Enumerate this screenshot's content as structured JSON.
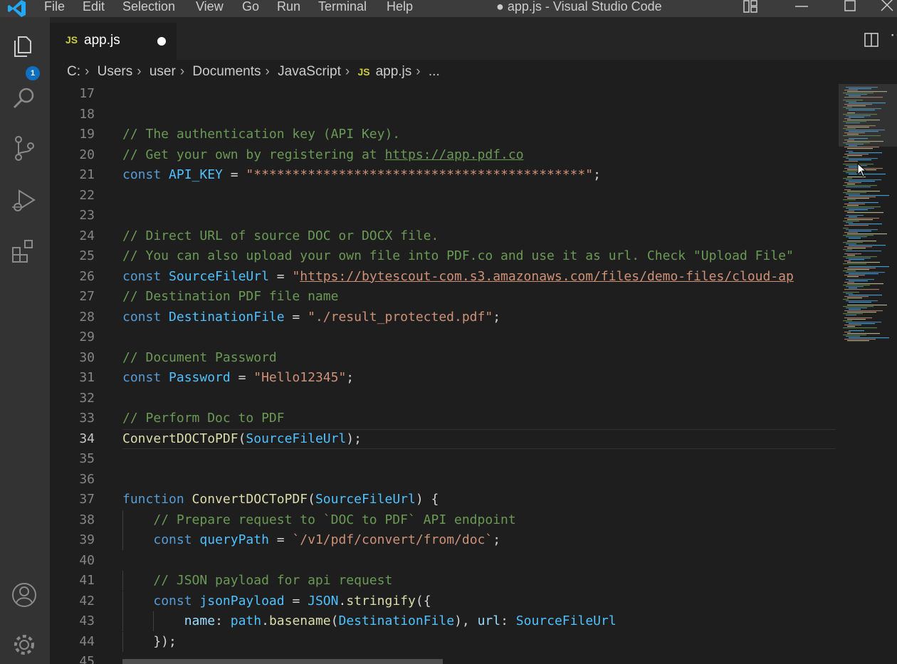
{
  "window": {
    "title": "● app.js - Visual Studio Code",
    "menu": [
      "File",
      "Edit",
      "Selection",
      "View",
      "Go",
      "Run",
      "Terminal",
      "Help"
    ]
  },
  "activity_bar": {
    "explorer_badge": "1",
    "icons": [
      "files-icon",
      "search-icon",
      "source-control-icon",
      "run-debug-icon",
      "extensions-icon",
      "account-icon",
      "settings-gear-icon"
    ]
  },
  "tab": {
    "language_badge": "JS",
    "label": "app.js",
    "dirty": true
  },
  "breadcrumb": {
    "items": [
      "C:",
      "Users",
      "user",
      "Documents",
      "JavaScript"
    ],
    "file_badge": "JS",
    "file": "app.js",
    "symbol": "..."
  },
  "editor": {
    "current_line": 34,
    "lines": [
      {
        "n": "17",
        "t": ""
      },
      {
        "n": "18",
        "t": ""
      },
      {
        "n": "19",
        "t": "// The authentication key (API Key)."
      },
      {
        "n": "20",
        "t": "// Get your own by registering at https://app.pdf.co"
      },
      {
        "n": "21",
        "t": "const API_KEY = \"*******************************************\";"
      },
      {
        "n": "22",
        "t": ""
      },
      {
        "n": "23",
        "t": ""
      },
      {
        "n": "24",
        "t": "// Direct URL of source DOC or DOCX file."
      },
      {
        "n": "25",
        "t": "// You can also upload your own file into PDF.co and use it as url. Check \"Upload File\""
      },
      {
        "n": "26",
        "t": "const SourceFileUrl = \"https://bytescout-com.s3.amazonaws.com/files/demo-files/cloud-ap"
      },
      {
        "n": "27",
        "t": "// Destination PDF file name"
      },
      {
        "n": "28",
        "t": "const DestinationFile = \"./result_protected.pdf\";"
      },
      {
        "n": "29",
        "t": ""
      },
      {
        "n": "30",
        "t": "// Document Password"
      },
      {
        "n": "31",
        "t": "const Password = \"Hello12345\";"
      },
      {
        "n": "32",
        "t": ""
      },
      {
        "n": "33",
        "t": "// Perform Doc to PDF"
      },
      {
        "n": "34",
        "t": "ConvertDOCToPDF(SourceFileUrl);"
      },
      {
        "n": "35",
        "t": ""
      },
      {
        "n": "36",
        "t": ""
      },
      {
        "n": "37",
        "t": "function ConvertDOCToPDF(SourceFileUrl) {"
      },
      {
        "n": "38",
        "t": "    // Prepare request to `DOC to PDF` API endpoint"
      },
      {
        "n": "39",
        "t": "    const queryPath = `/v1/pdf/convert/from/doc`;"
      },
      {
        "n": "40",
        "t": ""
      },
      {
        "n": "41",
        "t": "    // JSON payload for api request"
      },
      {
        "n": "42",
        "t": "    const jsonPayload = JSON.stringify({"
      },
      {
        "n": "43",
        "t": "        name: path.basename(DestinationFile), url: SourceFileUrl"
      },
      {
        "n": "44",
        "t": "    });"
      },
      {
        "n": "45",
        "t": ""
      }
    ]
  },
  "colors": {
    "comment": "#6a9955",
    "keyword": "#569cd6",
    "constant": "#4fc1ff",
    "string": "#ce9178",
    "function": "#dcdcaa",
    "property": "#9cdcfe",
    "background": "#1e1e1e"
  }
}
